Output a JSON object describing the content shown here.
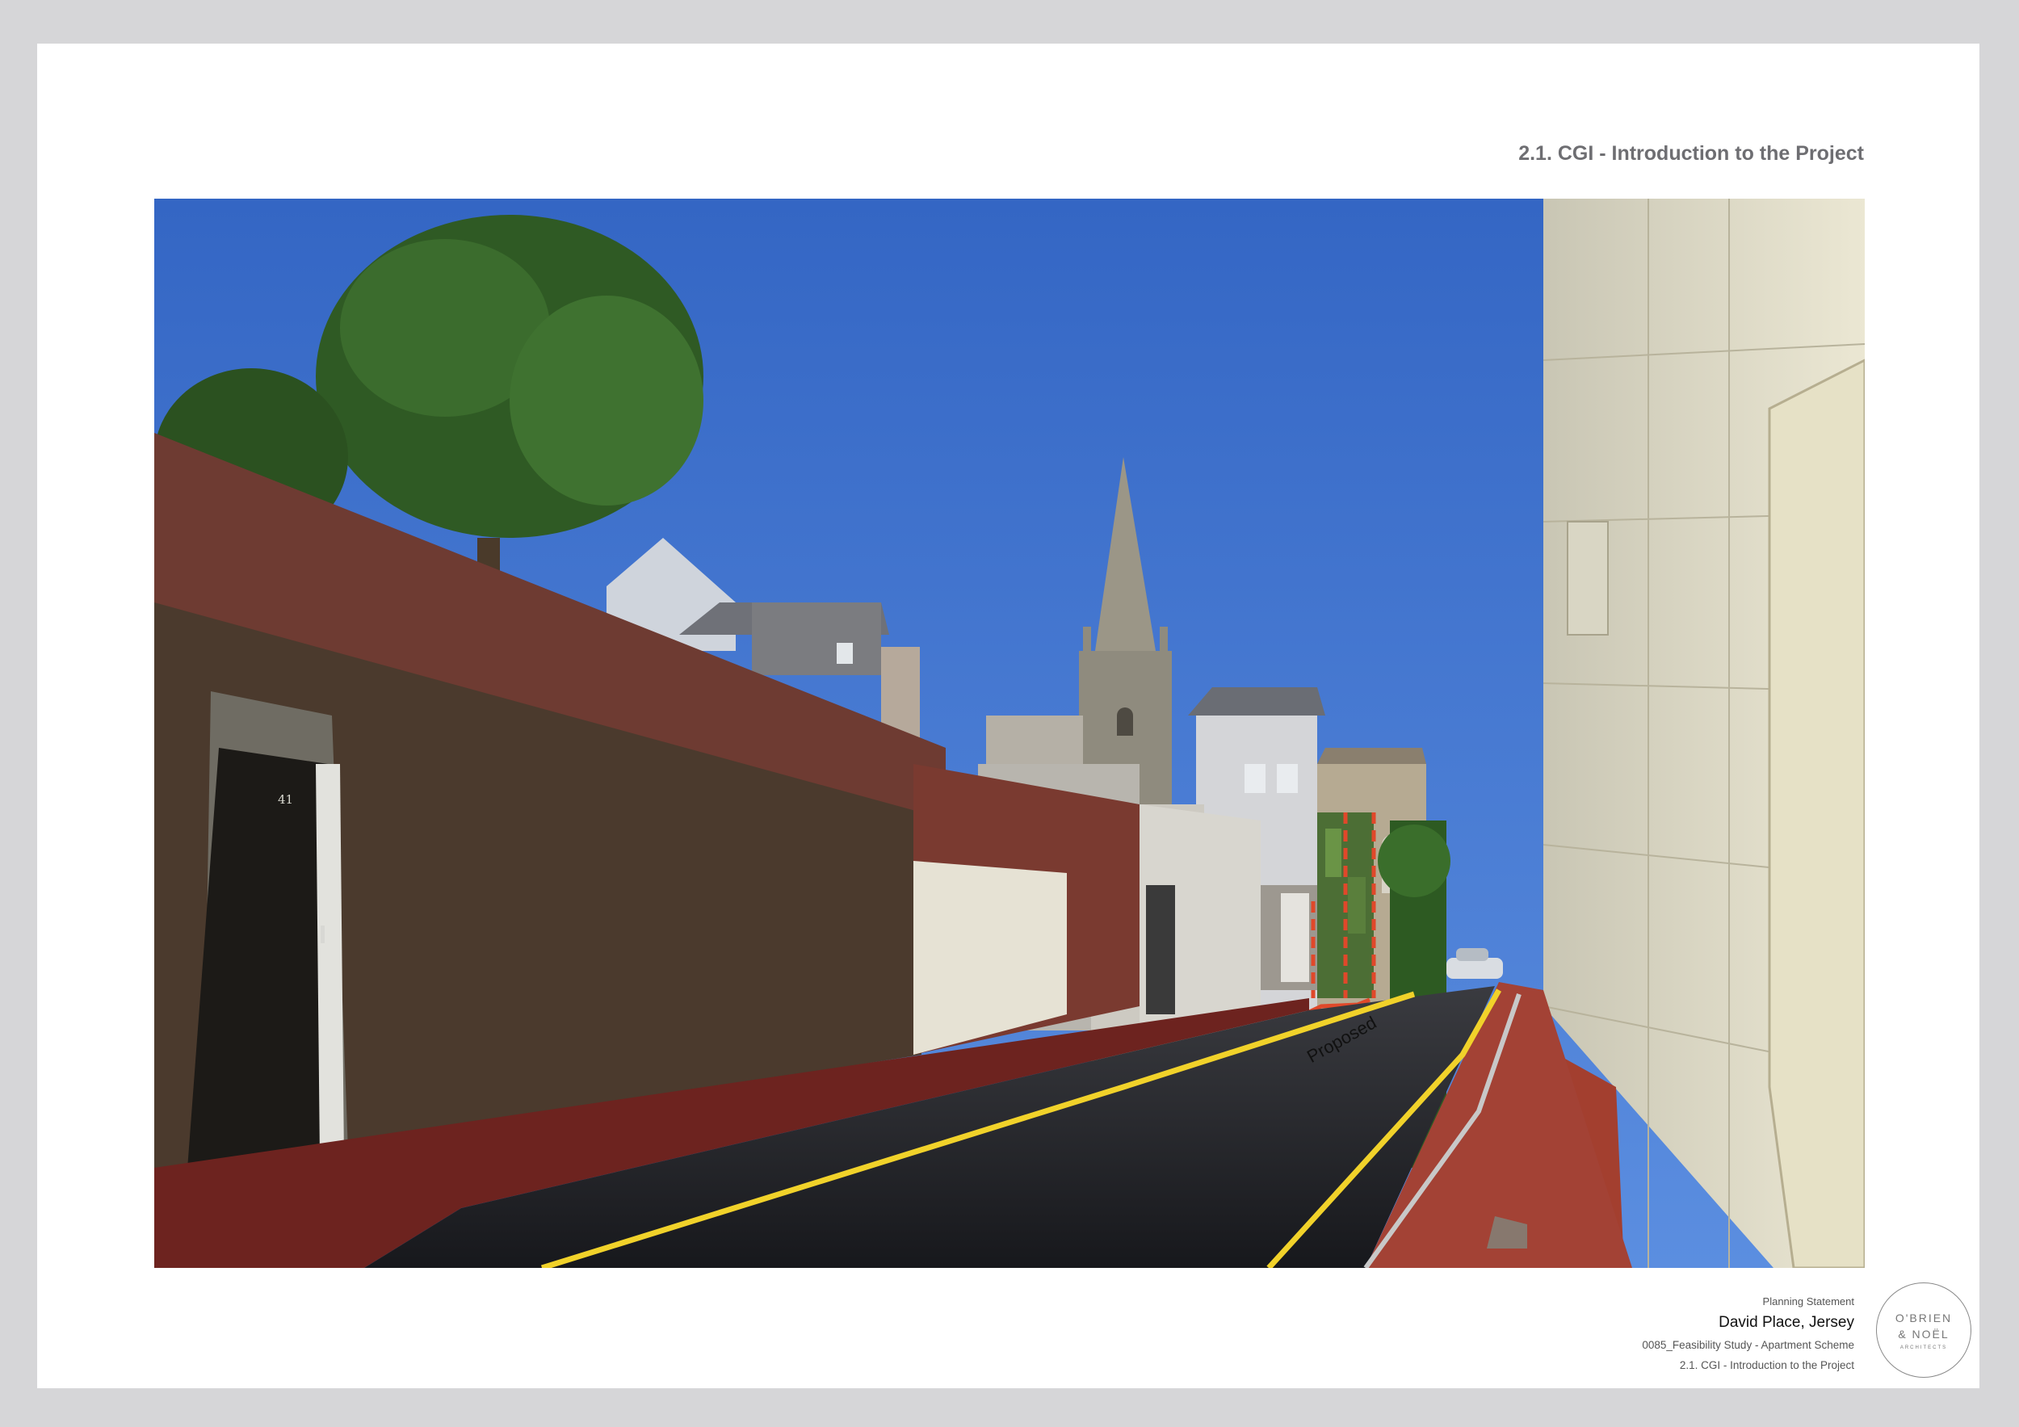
{
  "page": {
    "title": "2.1. CGI - Introduction to the Project"
  },
  "photo": {
    "annotation": "Proposed",
    "door_number": "41",
    "colors": {
      "sky": "#3f72cc",
      "annotation_outline": "#e0482a"
    }
  },
  "footer": {
    "document_type": "Planning Statement",
    "project": "David Place, Jersey",
    "scheme": "0085_Feasibility Study - Apartment Scheme",
    "sheet_title": "2.1. CGI - Introduction to the Project"
  },
  "logo": {
    "line1": "O'BRIEN",
    "line2": "& NOËL",
    "line3": "ARCHITECTS"
  }
}
